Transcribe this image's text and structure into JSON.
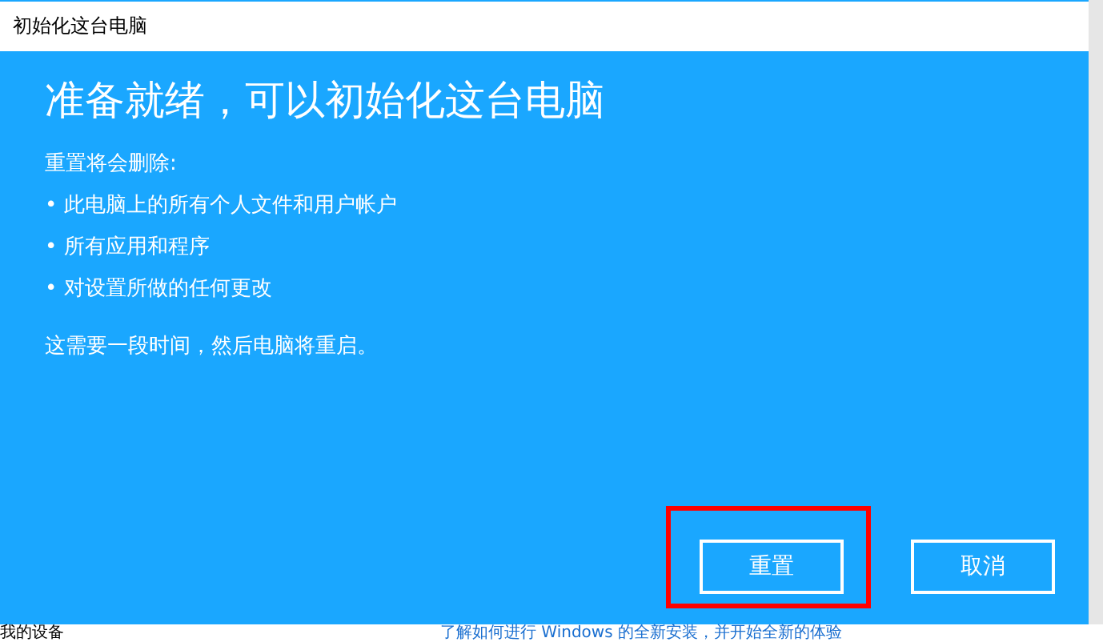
{
  "window": {
    "title": "初始化这台电脑"
  },
  "heading": "准备就绪，可以初始化这台电脑",
  "intro": "重置将会删除:",
  "items": [
    "• 此电脑上的所有个人文件和用户帐户",
    "• 所有应用和程序",
    "• 对设置所做的任何更改"
  ],
  "note": "这需要一段时间，然后电脑将重启。",
  "buttons": [
    {
      "label": "重置",
      "highlighted": true
    },
    {
      "label": "取消",
      "highlighted": false
    }
  ],
  "background": {
    "text": "我的设备",
    "link": "了解如何进行 Windows 的全新安装，并开始全新的体验"
  }
}
